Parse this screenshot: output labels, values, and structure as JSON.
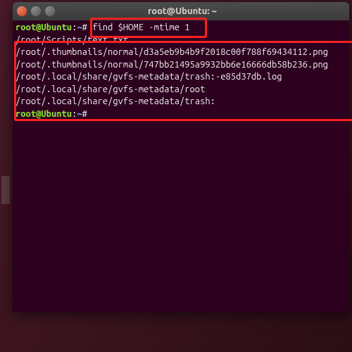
{
  "window": {
    "title": "root@Ubuntu: ~"
  },
  "prompt1": {
    "user": "root@Ubuntu",
    "colon": ":",
    "path": "~",
    "symbol": "#",
    "command": "find $HOME -mtime 1"
  },
  "output_lines": [
    "",
    "/root/Scripts/text.txt",
    "/root/.thumbnails/normal/d3a5eb9b4b9f2018c00f788f69434112.png",
    "/root/.thumbnails/normal/747bb21495a9932bb6e16666db58b236.png",
    "/root/.local/share/gvfs-metadata/trash:-e85d37db.log",
    "/root/.local/share/gvfs-metadata/root",
    "/root/.local/share/gvfs-metadata/trash:",
    ""
  ],
  "prompt2": {
    "user": "root@Ubuntu",
    "colon": ":",
    "path": "~",
    "symbol": "#"
  },
  "colors": {
    "terminal_bg": "#2c001e",
    "highlight": "#ff2020"
  }
}
